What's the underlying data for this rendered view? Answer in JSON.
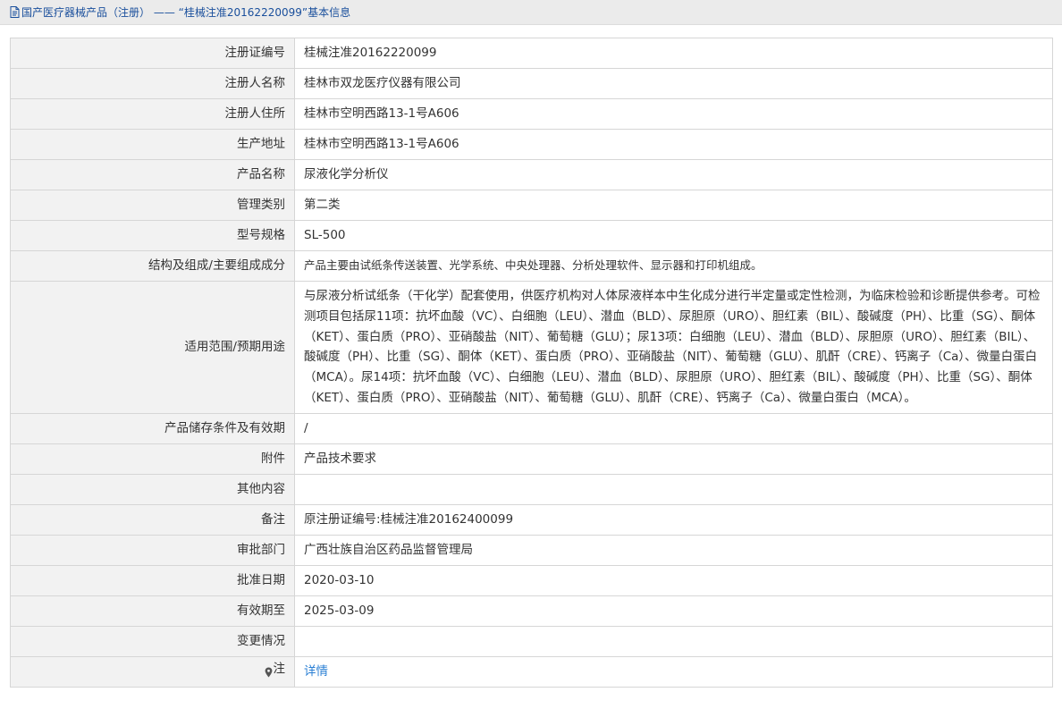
{
  "breadcrumb": {
    "icon": "document-icon",
    "category_link": "国产医疗器械产品（注册）",
    "separator": "——",
    "title": "“桂械注准20162220099”基本信息"
  },
  "rows": [
    {
      "label": "注册证编号",
      "value": "桂械注准20162220099"
    },
    {
      "label": "注册人名称",
      "value": "桂林市双龙医疗仪器有限公司"
    },
    {
      "label": "注册人住所",
      "value": "桂林市空明西路13-1号A606"
    },
    {
      "label": "生产地址",
      "value": "桂林市空明西路13-1号A606"
    },
    {
      "label": "产品名称",
      "value": "尿液化学分析仪"
    },
    {
      "label": "管理类别",
      "value": "第二类"
    },
    {
      "label": "型号规格",
      "value": "SL-500"
    },
    {
      "label": "结构及组成/主要组成成分",
      "value": "产品主要由试纸条传送装置、光学系统、中央处理器、分析处理软件、显示器和打印机组成。"
    },
    {
      "label": "适用范围/预期用途",
      "value": "与尿液分析试纸条（干化学）配套使用，供医疗机构对人体尿液样本中生化成分进行半定量或定性检测，为临床检验和诊断提供参考。可检测项目包括尿11项：抗坏血酸（VC）、白细胞（LEU）、潜血（BLD）、尿胆原（URO）、胆红素（BIL）、酸碱度（PH）、比重（SG）、酮体（KET）、蛋白质（PRO）、亚硝酸盐（NIT）、葡萄糖（GLU）；尿13项：白细胞（LEU）、潜血（BLD）、尿胆原（URO）、胆红素（BIL）、酸碱度（PH）、比重（SG）、酮体（KET）、蛋白质（PRO）、亚硝酸盐（NIT）、葡萄糖（GLU）、肌酐（CRE）、钙离子（Ca）、微量白蛋白（MCA）。尿14项：抗坏血酸（VC）、白细胞（LEU）、潜血（BLD）、尿胆原（URO）、胆红素（BIL）、酸碱度（PH）、比重（SG）、酮体（KET）、蛋白质（PRO）、亚硝酸盐（NIT）、葡萄糖（GLU）、肌酐（CRE）、钙离子（Ca）、微量白蛋白（MCA）。"
    },
    {
      "label": "产品储存条件及有效期",
      "value": "/"
    },
    {
      "label": "附件",
      "value": "产品技术要求"
    },
    {
      "label": "其他内容",
      "value": ""
    },
    {
      "label": "备注",
      "value": "原注册证编号:桂械注准20162400099"
    },
    {
      "label": "审批部门",
      "value": "广西壮族自治区药品监督管理局"
    },
    {
      "label": "批准日期",
      "value": "2020-03-10"
    },
    {
      "label": "有效期至",
      "value": "2025-03-09"
    },
    {
      "label": "变更情况",
      "value": ""
    }
  ],
  "note": {
    "icon": "location-pin-icon",
    "label": "注",
    "link": "详情"
  },
  "colors": {
    "link": "#2a7fd4",
    "breadcrumb": "#1a4f9c",
    "label_bg": "#f2f2f2",
    "border": "#d6d6d6"
  }
}
